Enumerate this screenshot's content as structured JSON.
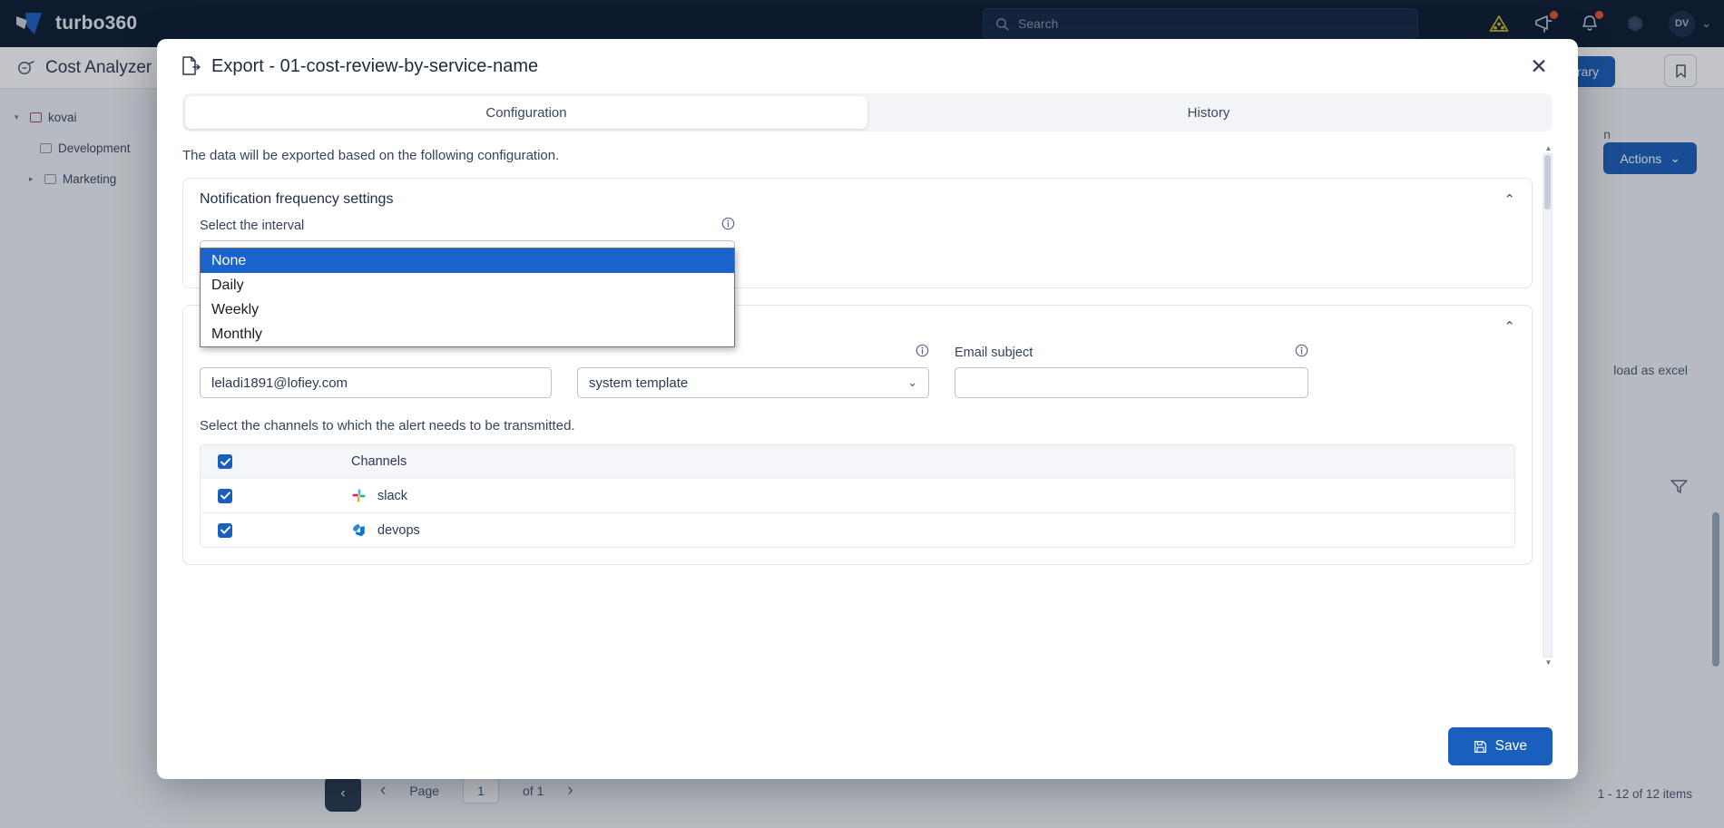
{
  "topbar": {
    "brand": "turbo360",
    "search_placeholder": "Search",
    "icons": [
      {
        "name": "warning-triangle-icon",
        "glyph": "⚠"
      },
      {
        "name": "megaphone-icon",
        "glyph": "📣",
        "badge": true
      },
      {
        "name": "bell-icon",
        "glyph": "🔔",
        "badge": true
      },
      {
        "name": "globe-icon",
        "glyph": "⬡"
      }
    ],
    "avatar_initials": "DV",
    "avatar_chevron": "⌄"
  },
  "page": {
    "title": "Cost Analyzer",
    "tree": [
      {
        "label": "kovai",
        "level": 0,
        "selected": true,
        "caret": "▾"
      },
      {
        "label": "Development",
        "level": 1,
        "selected": false,
        "caret": ""
      },
      {
        "label": "Marketing",
        "level": 1,
        "selected": false,
        "caret": "▸"
      }
    ],
    "buttons": {
      "library": "Library",
      "actions": "Actions",
      "actions_chevron": "⌄"
    },
    "labels": {
      "small_right": "n",
      "download_excel": "load as excel"
    },
    "pager": {
      "page_word": "Page",
      "page_value": "1",
      "of_label": "of 1",
      "prev": "‹",
      "next": "›",
      "first": "‹"
    },
    "items_count": "1 - 12 of 12 items"
  },
  "modal": {
    "title": "Export - 01-cost-review-by-service-name",
    "title_icon": "export-file-icon",
    "close_icon": "✕",
    "tabs": [
      {
        "label": "Configuration",
        "active": true
      },
      {
        "label": "History",
        "active": false
      }
    ],
    "hint": "The data will be exported based on the following configuration.",
    "notification_panel": {
      "heading": "Notification frequency settings",
      "collapse_chevron": "⌃",
      "interval_label": "Select the interval",
      "interval_value": "None",
      "interval_chevron": "⌄",
      "interval_options": [
        {
          "label": "None",
          "selected": true
        },
        {
          "label": "Daily",
          "selected": false
        },
        {
          "label": "Weekly",
          "selected": false
        },
        {
          "label": "Monthly",
          "selected": false
        }
      ]
    },
    "email_panel": {
      "collapse_chevron": "⌃",
      "email_label": "",
      "email_value": "leladi1891@lofiey.com",
      "template_label": "",
      "template_value": "system template",
      "template_chevron": "⌄",
      "subject_label": "Email subject",
      "subject_value": ""
    },
    "channels": {
      "hint": "Select the channels to which the alert needs to be transmitted.",
      "header": "Channels",
      "header_checked": true,
      "rows": [
        {
          "name": "slack",
          "checked": true,
          "icon": "slack-icon"
        },
        {
          "name": "devops",
          "checked": true,
          "icon": "devops-icon"
        }
      ]
    },
    "save_label": "Save",
    "save_icon": "save-disk-icon"
  },
  "colors": {
    "accent": "#1a5fbc",
    "topbar": "#0d1c33",
    "highlight": "#1a62cc",
    "badge": "#e8542a",
    "warning": "#d8c325"
  }
}
